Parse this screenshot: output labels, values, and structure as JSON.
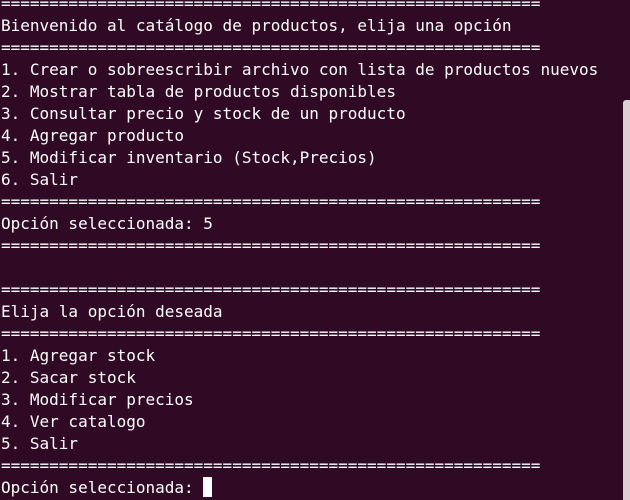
{
  "terminal": {
    "lines": [
      "========================================================",
      "Bienvenido al catálogo de productos, elija una opción",
      "========================================================",
      "1. Crear o sobreescribir archivo con lista de productos nuevos",
      "2. Mostrar tabla de productos disponibles",
      "3. Consultar precio y stock de un producto",
      "4. Agregar producto",
      "5. Modificar inventario (Stock,Precios)",
      "6. Salir",
      "========================================================",
      "Opción seleccionada: 5",
      "========================================================",
      "",
      "========================================================",
      "Elija la opción deseada",
      "========================================================",
      "1. Agregar stock",
      "2. Sacar stock",
      "3. Modificar precios",
      "4. Ver catalogo",
      "5. Salir",
      "========================================================",
      "Opción seleccionada: "
    ]
  },
  "colors": {
    "background": "#300a24",
    "text": "#ffffff",
    "scrollbar": "#d7d0d4"
  }
}
